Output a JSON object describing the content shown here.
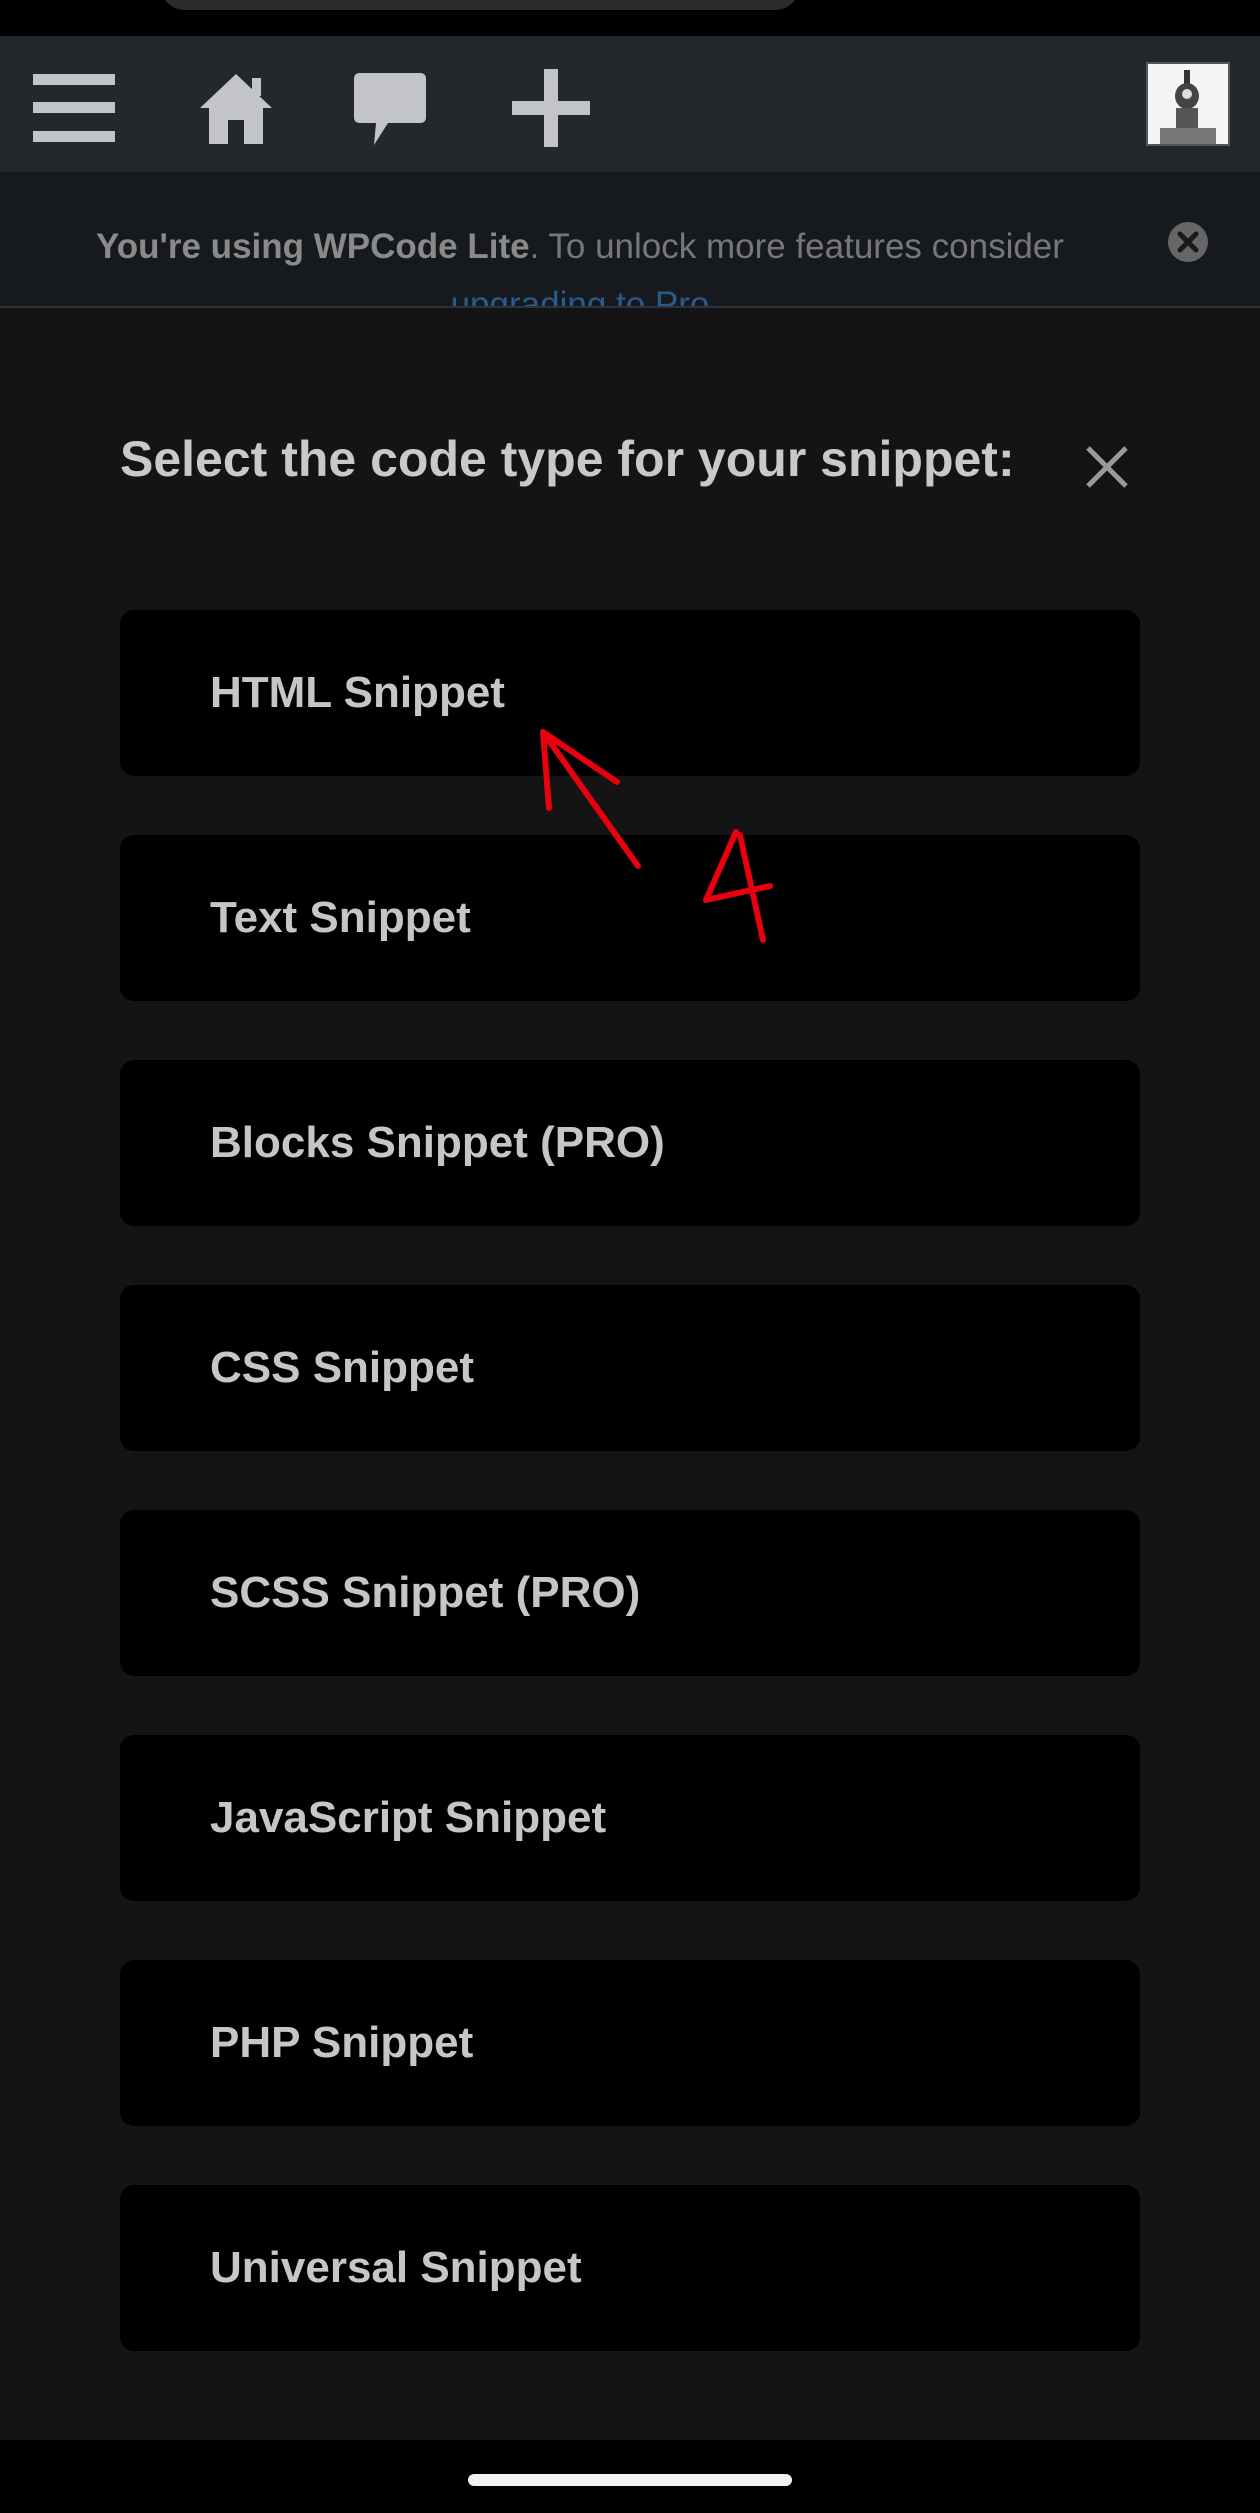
{
  "adminbar": {
    "icons": [
      "menu-icon",
      "home-icon",
      "comment-icon",
      "plus-icon"
    ],
    "avatar": "user-avatar"
  },
  "notice": {
    "bold_text": "You're using WPCode Lite",
    "text": ". To unlock more features consider ",
    "link_text": "upgrading to Pro"
  },
  "modal": {
    "title": "Select the code type for your snippet:",
    "options": [
      "HTML Snippet",
      "Text Snippet",
      "Blocks Snippet (PRO)",
      "CSS Snippet",
      "SCSS Snippet (PRO)",
      "JavaScript Snippet",
      "PHP Snippet",
      "Universal Snippet"
    ]
  },
  "annotation": {
    "step_number": "4",
    "color": "#e8000f"
  },
  "colors": {
    "background": "#141414",
    "adminbar": "#23282d",
    "option_bg": "#000000",
    "text": "#c6c6c6"
  }
}
